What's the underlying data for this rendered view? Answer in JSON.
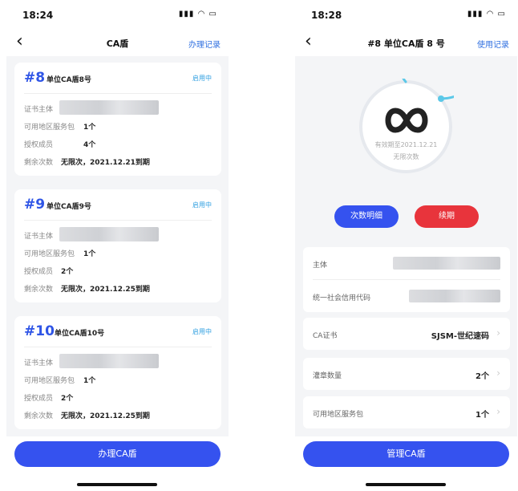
{
  "left": {
    "status_time": "18:24",
    "title": "CA盾",
    "nav_right": "办理记录",
    "cards": [
      {
        "no": "#8",
        "name": "单位CA盾8号",
        "status": "启用中",
        "label_subject": "证书主体",
        "label_region": "可用地区服务包",
        "region": "1个",
        "label_members": "授权成员",
        "members": "4个",
        "label_remaining": "剩余次数",
        "remaining": "无限次，2021.12.21到期"
      },
      {
        "no": "#9",
        "name": "单位CA盾9号",
        "status": "启用中",
        "label_subject": "证书主体",
        "label_region": "可用地区服务包",
        "region": "1个",
        "label_members": "授权成员",
        "members": "2个",
        "label_remaining": "剩余次数",
        "remaining": "无限次，2021.12.25到期"
      },
      {
        "no": "#10",
        "name": "单位CA盾10号",
        "status": "启用中",
        "label_subject": "证书主体",
        "label_region": "可用地区服务包",
        "region": "1个",
        "label_members": "授权成员",
        "members": "2个",
        "label_remaining": "剩余次数",
        "remaining": "无限次，2021.12.25到期"
      }
    ],
    "main_button": "办理CA盾"
  },
  "right": {
    "status_time": "18:28",
    "title": "#8 单位CA盾 8 号",
    "nav_right": "使用记录",
    "validity": "有效期至2021.12.21",
    "times": "无限次数",
    "btn_detail": "次数明细",
    "btn_renew": "续期",
    "label_subject": "主体",
    "label_credit_code": "统一社会信用代码",
    "label_ca_cert": "CA证书",
    "ca_cert_value": "SJSM-世纪速码",
    "label_seal_count": "灌章数量",
    "seal_count": "2个",
    "label_region": "可用地区服务包",
    "region_count": "1个",
    "main_button": "管理CA盾"
  },
  "colors": {
    "accent": "#3552ef",
    "danger": "#e8343c",
    "link": "#2f6fe0",
    "ring": "#5bc8e8"
  },
  "icons": {
    "back": "chevron-left-icon",
    "signal": "signal-icon",
    "wifi": "wifi-icon",
    "battery": "battery-icon",
    "chevron": "chevron-right-icon",
    "logo": "infinity-logo"
  }
}
